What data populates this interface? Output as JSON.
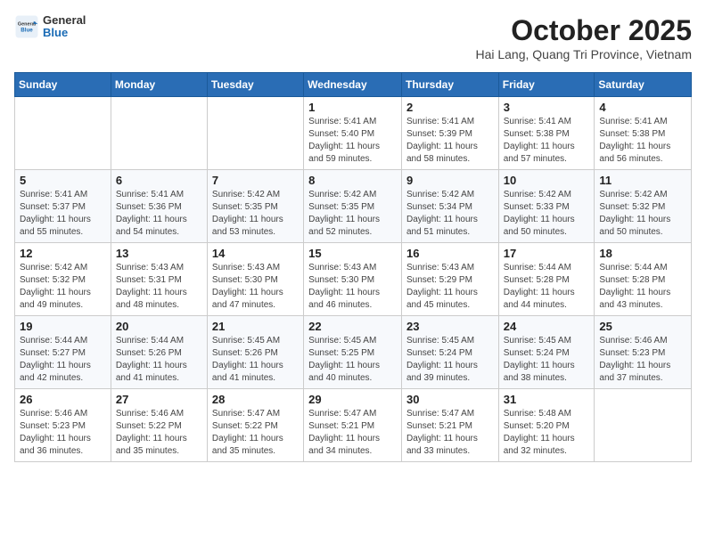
{
  "header": {
    "logo_general": "General",
    "logo_blue": "Blue",
    "month_title": "October 2025",
    "subtitle": "Hai Lang, Quang Tri Province, Vietnam"
  },
  "days_of_week": [
    "Sunday",
    "Monday",
    "Tuesday",
    "Wednesday",
    "Thursday",
    "Friday",
    "Saturday"
  ],
  "weeks": [
    [
      {
        "day": "",
        "content": ""
      },
      {
        "day": "",
        "content": ""
      },
      {
        "day": "",
        "content": ""
      },
      {
        "day": "1",
        "content": "Sunrise: 5:41 AM\nSunset: 5:40 PM\nDaylight: 11 hours\nand 59 minutes."
      },
      {
        "day": "2",
        "content": "Sunrise: 5:41 AM\nSunset: 5:39 PM\nDaylight: 11 hours\nand 58 minutes."
      },
      {
        "day": "3",
        "content": "Sunrise: 5:41 AM\nSunset: 5:38 PM\nDaylight: 11 hours\nand 57 minutes."
      },
      {
        "day": "4",
        "content": "Sunrise: 5:41 AM\nSunset: 5:38 PM\nDaylight: 11 hours\nand 56 minutes."
      }
    ],
    [
      {
        "day": "5",
        "content": "Sunrise: 5:41 AM\nSunset: 5:37 PM\nDaylight: 11 hours\nand 55 minutes."
      },
      {
        "day": "6",
        "content": "Sunrise: 5:41 AM\nSunset: 5:36 PM\nDaylight: 11 hours\nand 54 minutes."
      },
      {
        "day": "7",
        "content": "Sunrise: 5:42 AM\nSunset: 5:35 PM\nDaylight: 11 hours\nand 53 minutes."
      },
      {
        "day": "8",
        "content": "Sunrise: 5:42 AM\nSunset: 5:35 PM\nDaylight: 11 hours\nand 52 minutes."
      },
      {
        "day": "9",
        "content": "Sunrise: 5:42 AM\nSunset: 5:34 PM\nDaylight: 11 hours\nand 51 minutes."
      },
      {
        "day": "10",
        "content": "Sunrise: 5:42 AM\nSunset: 5:33 PM\nDaylight: 11 hours\nand 50 minutes."
      },
      {
        "day": "11",
        "content": "Sunrise: 5:42 AM\nSunset: 5:32 PM\nDaylight: 11 hours\nand 50 minutes."
      }
    ],
    [
      {
        "day": "12",
        "content": "Sunrise: 5:42 AM\nSunset: 5:32 PM\nDaylight: 11 hours\nand 49 minutes."
      },
      {
        "day": "13",
        "content": "Sunrise: 5:43 AM\nSunset: 5:31 PM\nDaylight: 11 hours\nand 48 minutes."
      },
      {
        "day": "14",
        "content": "Sunrise: 5:43 AM\nSunset: 5:30 PM\nDaylight: 11 hours\nand 47 minutes."
      },
      {
        "day": "15",
        "content": "Sunrise: 5:43 AM\nSunset: 5:30 PM\nDaylight: 11 hours\nand 46 minutes."
      },
      {
        "day": "16",
        "content": "Sunrise: 5:43 AM\nSunset: 5:29 PM\nDaylight: 11 hours\nand 45 minutes."
      },
      {
        "day": "17",
        "content": "Sunrise: 5:44 AM\nSunset: 5:28 PM\nDaylight: 11 hours\nand 44 minutes."
      },
      {
        "day": "18",
        "content": "Sunrise: 5:44 AM\nSunset: 5:28 PM\nDaylight: 11 hours\nand 43 minutes."
      }
    ],
    [
      {
        "day": "19",
        "content": "Sunrise: 5:44 AM\nSunset: 5:27 PM\nDaylight: 11 hours\nand 42 minutes."
      },
      {
        "day": "20",
        "content": "Sunrise: 5:44 AM\nSunset: 5:26 PM\nDaylight: 11 hours\nand 41 minutes."
      },
      {
        "day": "21",
        "content": "Sunrise: 5:45 AM\nSunset: 5:26 PM\nDaylight: 11 hours\nand 41 minutes."
      },
      {
        "day": "22",
        "content": "Sunrise: 5:45 AM\nSunset: 5:25 PM\nDaylight: 11 hours\nand 40 minutes."
      },
      {
        "day": "23",
        "content": "Sunrise: 5:45 AM\nSunset: 5:24 PM\nDaylight: 11 hours\nand 39 minutes."
      },
      {
        "day": "24",
        "content": "Sunrise: 5:45 AM\nSunset: 5:24 PM\nDaylight: 11 hours\nand 38 minutes."
      },
      {
        "day": "25",
        "content": "Sunrise: 5:46 AM\nSunset: 5:23 PM\nDaylight: 11 hours\nand 37 minutes."
      }
    ],
    [
      {
        "day": "26",
        "content": "Sunrise: 5:46 AM\nSunset: 5:23 PM\nDaylight: 11 hours\nand 36 minutes."
      },
      {
        "day": "27",
        "content": "Sunrise: 5:46 AM\nSunset: 5:22 PM\nDaylight: 11 hours\nand 35 minutes."
      },
      {
        "day": "28",
        "content": "Sunrise: 5:47 AM\nSunset: 5:22 PM\nDaylight: 11 hours\nand 35 minutes."
      },
      {
        "day": "29",
        "content": "Sunrise: 5:47 AM\nSunset: 5:21 PM\nDaylight: 11 hours\nand 34 minutes."
      },
      {
        "day": "30",
        "content": "Sunrise: 5:47 AM\nSunset: 5:21 PM\nDaylight: 11 hours\nand 33 minutes."
      },
      {
        "day": "31",
        "content": "Sunrise: 5:48 AM\nSunset: 5:20 PM\nDaylight: 11 hours\nand 32 minutes."
      },
      {
        "day": "",
        "content": ""
      }
    ]
  ]
}
